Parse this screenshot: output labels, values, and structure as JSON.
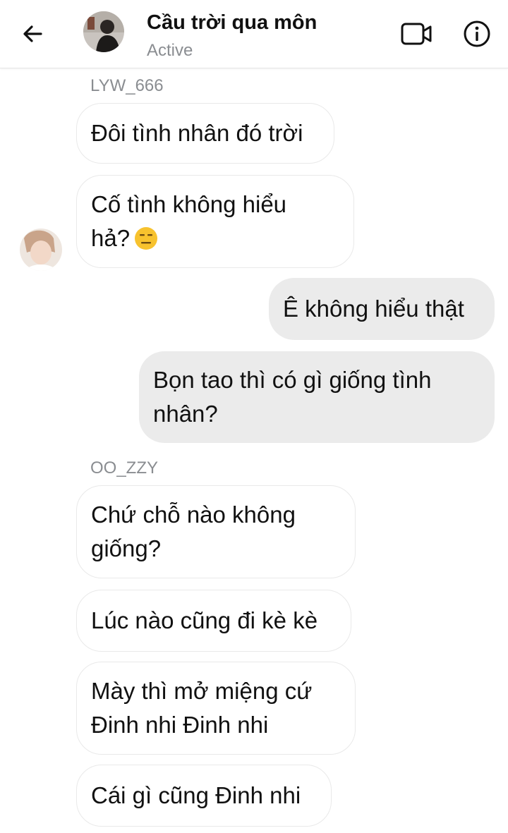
{
  "header": {
    "title": "Cầu trời qua môn",
    "status": "Active",
    "back_icon": "back-arrow-icon",
    "video_icon": "video-call-icon",
    "info_icon": "info-icon"
  },
  "messages": [
    {
      "sender_label": "LYW_666"
    },
    {
      "direction": "incoming",
      "lines": [
        "Đôi tình nhân đó trời"
      ]
    },
    {
      "direction": "incoming",
      "lines": [
        "Cố tình không hiểu",
        "hả?"
      ],
      "emoji": "expressionless-face-emoji"
    },
    {
      "direction": "outgoing",
      "lines": [
        "Ê không hiểu thật"
      ]
    },
    {
      "direction": "outgoing",
      "lines": [
        "Bọn tao thì có gì giống tình",
        "nhân?"
      ]
    },
    {
      "sender_label": "OO_ZZY"
    },
    {
      "direction": "incoming",
      "lines": [
        "Chứ chỗ nào không",
        "giống?"
      ]
    },
    {
      "direction": "incoming",
      "lines": [
        "Lúc nào cũng đi kè kè"
      ]
    },
    {
      "direction": "incoming",
      "lines": [
        "Mày thì mở miệng cứ",
        "Đinh nhi Đinh nhi"
      ]
    },
    {
      "direction": "incoming",
      "lines": [
        "Cái gì cũng Đinh nhi"
      ]
    }
  ],
  "colors": {
    "incoming_bubble": "#ffffff",
    "outgoing_bubble": "#ebebeb",
    "muted_text": "#8a8d91",
    "emoji": "#f7c22e"
  }
}
